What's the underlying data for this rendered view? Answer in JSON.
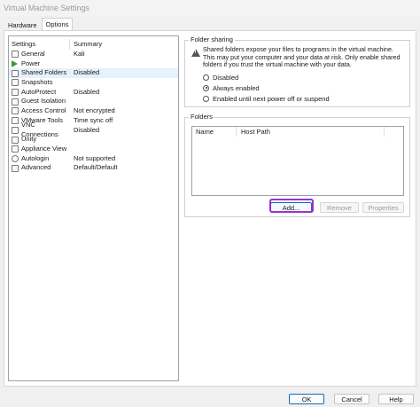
{
  "window": {
    "title": "Virtual Machine Settings"
  },
  "tabs": [
    {
      "label": "Hardware"
    },
    {
      "label": "Options"
    }
  ],
  "settings_list": {
    "headers": {
      "setting": "Settings",
      "summary": "Summary"
    },
    "items": [
      {
        "label": "General",
        "summary": "Kali",
        "icon": "general-icon"
      },
      {
        "label": "Power",
        "summary": "",
        "icon": "power-icon"
      },
      {
        "label": "Shared Folders",
        "summary": "Disabled",
        "icon": "shared-folders-icon"
      },
      {
        "label": "Snapshots",
        "summary": "",
        "icon": "snapshots-icon"
      },
      {
        "label": "AutoProtect",
        "summary": "Disabled",
        "icon": "autoprotect-icon"
      },
      {
        "label": "Guest Isolation",
        "summary": "",
        "icon": "guest-isolation-icon"
      },
      {
        "label": "Access Control",
        "summary": "Not encrypted",
        "icon": "access-control-icon"
      },
      {
        "label": "VMware Tools",
        "summary": "Time sync off",
        "icon": "vmware-tools-icon"
      },
      {
        "label": "VNC Connections",
        "summary": "Disabled",
        "icon": "vnc-icon"
      },
      {
        "label": "Unity",
        "summary": "",
        "icon": "unity-icon"
      },
      {
        "label": "Appliance View",
        "summary": "",
        "icon": "appliance-view-icon"
      },
      {
        "label": "Autologin",
        "summary": "Not supported",
        "icon": "autologin-icon"
      },
      {
        "label": "Advanced",
        "summary": "Default/Default",
        "icon": "advanced-icon"
      }
    ]
  },
  "folder_sharing": {
    "title": "Folder sharing",
    "warning": "Shared folders expose your files to programs in the virtual machine. This may put your computer and your data at risk. Only enable shared folders if you trust the virtual machine with your data.",
    "options": [
      {
        "label": "Disabled",
        "checked": false
      },
      {
        "label": "Always enabled",
        "checked": true
      },
      {
        "label": "Enabled until next power off or suspend",
        "checked": false
      }
    ]
  },
  "folders": {
    "title": "Folders",
    "columns": [
      "Name",
      "Host Path"
    ],
    "rows": [],
    "add_label": "Add...",
    "remove_label": "Remove",
    "properties_label": "Properties"
  },
  "footer": {
    "ok_label": "OK",
    "cancel_label": "Cancel",
    "help_label": "Help"
  },
  "colors": {
    "highlight_outline": "#9b30d0",
    "default_button_border": "#0f6cbd"
  }
}
